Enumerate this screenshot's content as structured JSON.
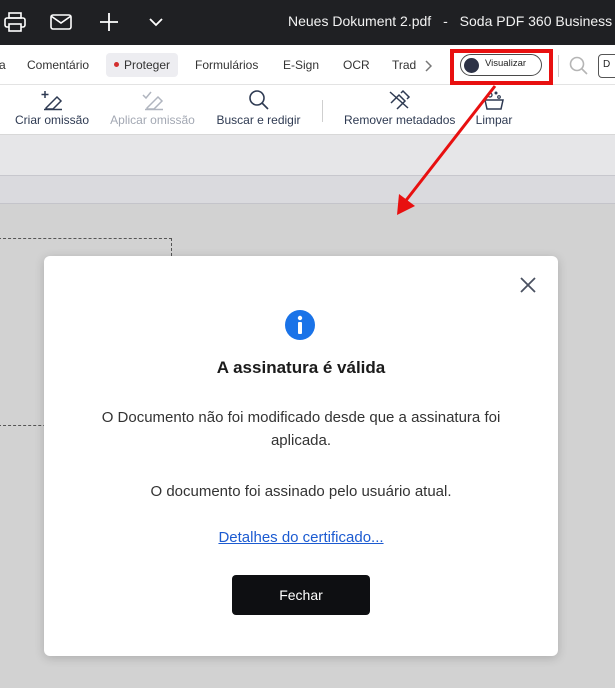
{
  "titlebar": {
    "document_name": "Neues Dokument 2.pdf",
    "separator": "-",
    "app_name": "Soda PDF 360 Business",
    "icons": [
      "print-icon",
      "mail-icon",
      "plus-icon",
      "chevron-down-icon"
    ]
  },
  "tabs": {
    "items": [
      {
        "label": "a",
        "active": false
      },
      {
        "label": "Comentário",
        "active": false
      },
      {
        "label": "Proteger",
        "active": true
      },
      {
        "label": "Formulários",
        "active": false
      },
      {
        "label": "E-Sign",
        "active": false
      },
      {
        "label": "OCR",
        "active": false
      },
      {
        "label": "Trad",
        "active": false
      }
    ],
    "more_icon": "chevron-right-icon",
    "toggle_label": "Visualizar",
    "search_icon": "search-icon",
    "edge_button_label": "D"
  },
  "tools": {
    "items": [
      {
        "label": "Criar omissão",
        "icon": "redact-add-icon",
        "disabled": false
      },
      {
        "label": "Aplicar omissão",
        "icon": "redact-apply-icon",
        "disabled": true
      },
      {
        "label": "Buscar e redigir",
        "icon": "search-icon",
        "disabled": false
      },
      {
        "label": "Remover metadados",
        "icon": "remove-metadata-icon",
        "disabled": false
      },
      {
        "label": "Limpar",
        "icon": "sanitize-icon",
        "disabled": false
      }
    ]
  },
  "dialog": {
    "title": "A assinatura é válida",
    "message1": "O Documento não foi modificado desde que a assinatura foi aplicada.",
    "message2": "O documento foi assinado pelo usuário atual.",
    "link": "Detalhes do certificado...",
    "close_button": "Fechar",
    "icon": "info-icon",
    "close_icon": "close-icon"
  },
  "colors": {
    "accent_red": "#e81010",
    "info_blue": "#1a73e8",
    "link_blue": "#1c5bd1",
    "button_dark": "#0e0f12"
  }
}
